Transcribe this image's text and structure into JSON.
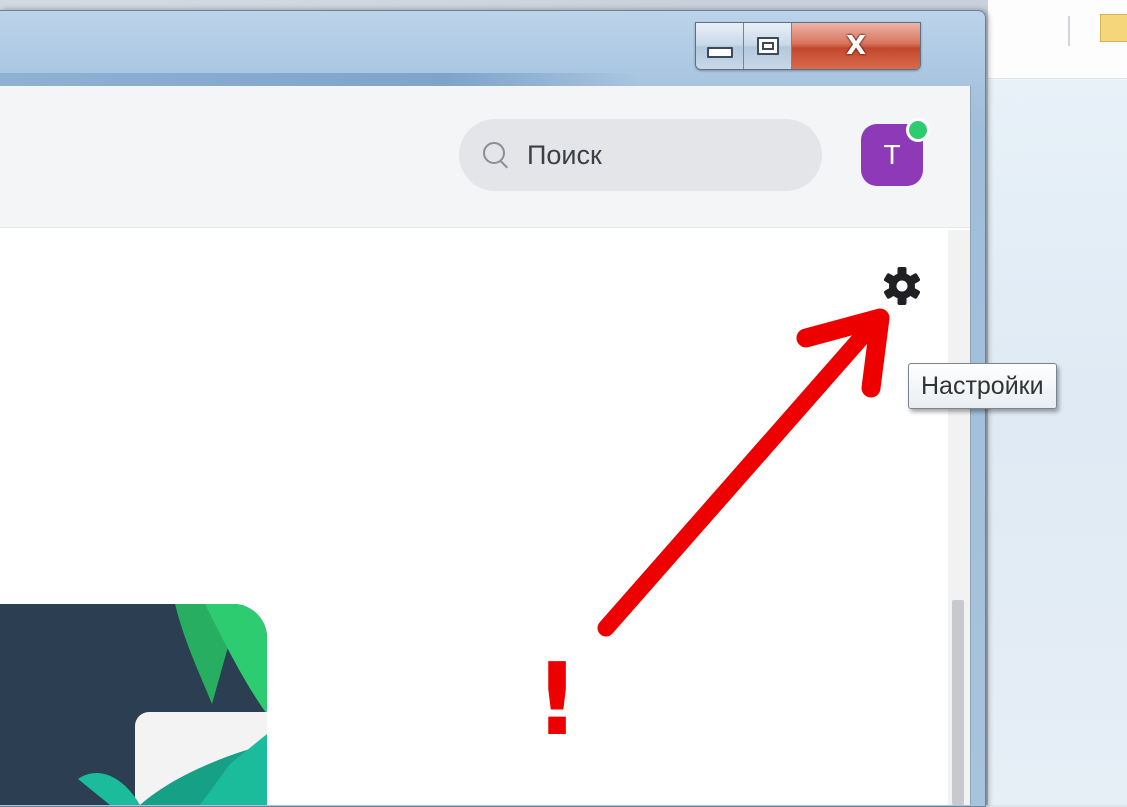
{
  "window": {
    "controls": {
      "minimize": "",
      "maximize": "",
      "close": "X"
    }
  },
  "header": {
    "search": {
      "placeholder": "Поиск"
    },
    "avatar": {
      "initial": "T",
      "status": "online"
    }
  },
  "settings": {
    "icon": "gear-icon",
    "tooltip": "Настройки"
  },
  "annotation": {
    "mark": "!",
    "color": "#ee0000"
  },
  "colors": {
    "avatar_bg": "#8e3ab8",
    "presence": "#2ecc71",
    "search_bg": "#e4e5e8"
  }
}
